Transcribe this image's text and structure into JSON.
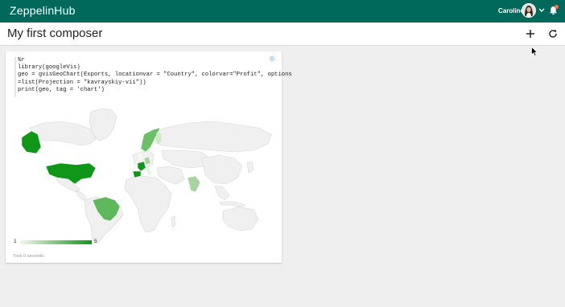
{
  "topbar": {
    "brand": "ZeppelinHub",
    "user_name": "Caroline",
    "icons": [
      "avatar",
      "chevron-down-icon",
      "bell-icon"
    ]
  },
  "header": {
    "title": "My first composer",
    "icons": [
      "plus-icon",
      "refresh-icon"
    ]
  },
  "paragraph": {
    "code_lines": [
      "%r",
      "library(googleVis)",
      "geo = gvisGeoChart(Exports, locationvar = \"Country\", colorvar=\"Profit\", options",
      "=list(Projection = \"kavrayskiy-vii\"))",
      "print(geo, tag = 'chart')"
    ],
    "legend": {
      "min": "1",
      "max": "5"
    },
    "status": "Took 0 seconds."
  },
  "colors": {
    "topbar": "#00695c",
    "map_high": "#109618",
    "map_low": "#f3f7ec",
    "map_empty": "#f0f0f0"
  }
}
